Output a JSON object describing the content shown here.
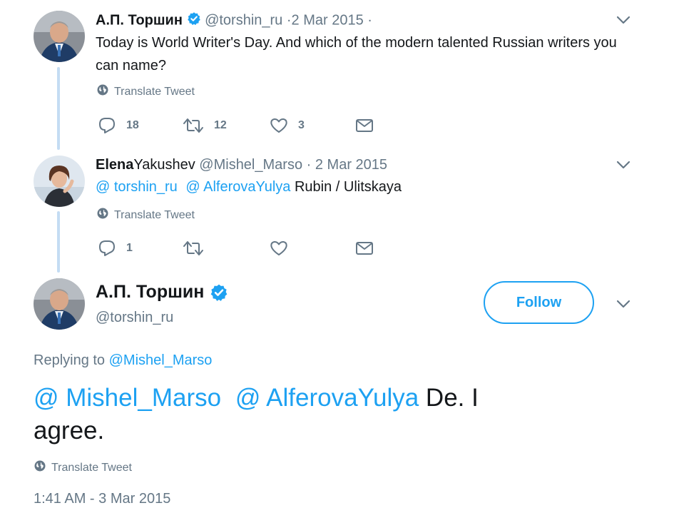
{
  "tweet1": {
    "display_name": "А.П. Торшин",
    "handle": "@torshin_ru",
    "date": "·2 Mar 2015 ·",
    "text": "Today is World Writer's Day. And which of the modern talented Russian writers you can name?",
    "translate": "Translate Tweet",
    "replies": "18",
    "retweets": "12",
    "likes": "3"
  },
  "tweet2": {
    "display_name_bold": "Elena",
    "display_name_rest": "Yakushev",
    "handle": "@Mishel_Marso",
    "date": "· 2 Mar 2015",
    "mention1": "@ torshin_ru",
    "mention2": "@ AlferovaYulya",
    "text": "Rubin / Ulitskaya",
    "translate": "Translate Tweet",
    "replies": "1"
  },
  "main_tweet": {
    "display_name": "А.П. Торшин",
    "handle": "@torshin_ru",
    "follow_label": "Follow",
    "replying_label": "Replying to",
    "replying_handle": "@Mishel_Marso",
    "mention1": "@ Mishel_Marso",
    "mention2": "@ AlferovaYulya",
    "text_line1_end": "De. I",
    "text_line2": "agree.",
    "translate": "Translate Tweet",
    "timestamp": "1:41 AM - 3 Mar 2015"
  },
  "colors": {
    "accent": "#1da1f2",
    "muted": "#657786",
    "text": "#14171a",
    "thread_line": "#c4dcf3"
  },
  "icons": [
    "verified-badge-icon",
    "globe-icon",
    "reply-icon",
    "retweet-icon",
    "like-icon",
    "direct-message-icon",
    "chevron-down-icon"
  ]
}
